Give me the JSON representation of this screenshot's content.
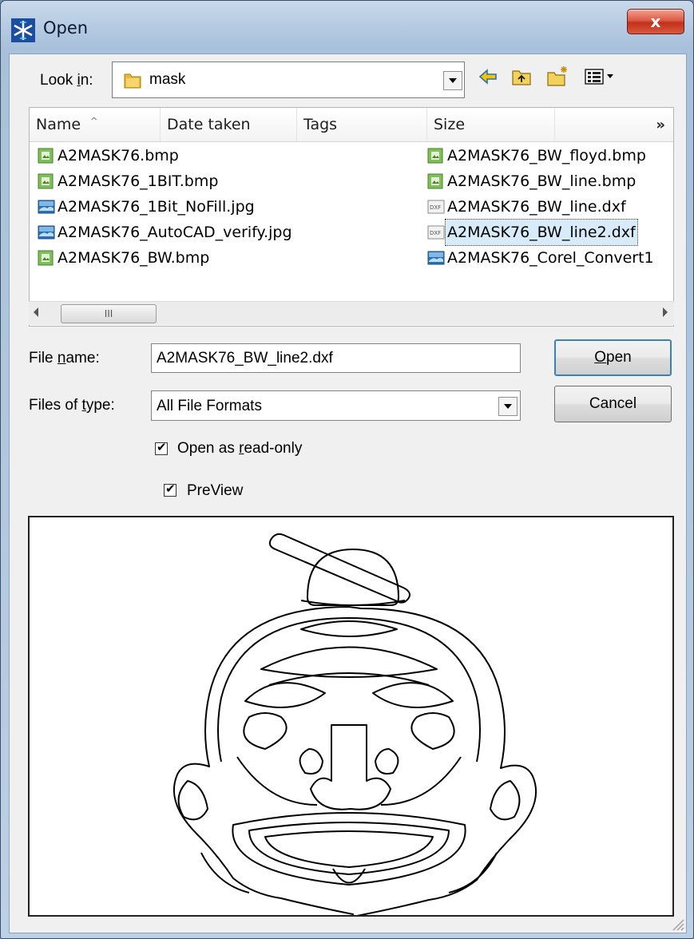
{
  "window": {
    "title": "Open",
    "close_symbol": "x"
  },
  "lookin": {
    "label_prefix": "Look ",
    "label_accel": "i",
    "label_suffix": "n:",
    "folder": "mask"
  },
  "columns": [
    "Name",
    "Date taken",
    "Tags",
    "Size"
  ],
  "more_columns_symbol": "»",
  "files": [
    {
      "name": "A2MASK76.bmp",
      "icon": "bmp-image-icon"
    },
    {
      "name": "A2MASK76_1BIT.bmp",
      "icon": "bmp-image-icon"
    },
    {
      "name": "A2MASK76_1Bit_NoFill.jpg",
      "icon": "jpg-image-icon"
    },
    {
      "name": "A2MASK76_AutoCAD_verify.jpg",
      "icon": "jpg-image-icon"
    },
    {
      "name": "A2MASK76_BW.bmp",
      "icon": "bmp-image-icon"
    },
    {
      "name": "A2MASK76_BW_floyd.bmp",
      "icon": "bmp-image-icon"
    },
    {
      "name": "A2MASK76_BW_line.bmp",
      "icon": "bmp-image-icon"
    },
    {
      "name": "A2MASK76_BW_line.dxf",
      "icon": "dxf-file-icon"
    },
    {
      "name": "A2MASK76_BW_line2.dxf",
      "icon": "dxf-file-icon",
      "selected": true
    },
    {
      "name": "A2MASK76_Corel_Convert1",
      "icon": "jpg-image-icon"
    }
  ],
  "scroll_thumb_text": "III",
  "filename": {
    "label_prefix": "File ",
    "label_accel": "n",
    "label_suffix": "ame:",
    "value": "A2MASK76_BW_line2.dxf"
  },
  "filetype": {
    "label_prefix": "Files of ",
    "label_accel": "t",
    "label_suffix": "ype:",
    "value": "All File Formats"
  },
  "buttons": {
    "open_accel": "O",
    "open_rest": "pen",
    "cancel": "Cancel"
  },
  "readonly": {
    "prefix": "Open as ",
    "accel": "r",
    "suffix": "ead-only",
    "checked": true
  },
  "preview_opt": {
    "label": "PreView",
    "checked": true
  },
  "colors": {
    "selection": "#d8ebfa",
    "close_button": "#c9432c",
    "default_button_border": "#3c7fb1"
  }
}
